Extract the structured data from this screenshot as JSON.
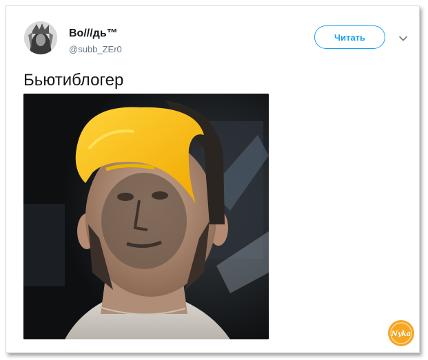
{
  "tweet": {
    "author_name": "Во///дь™",
    "author_handle": "@subb_ZEr0",
    "follow_label": "Читать",
    "text": "Бьютиблогер"
  },
  "icons": {
    "avatar": "avatar-portrait",
    "caret": "chevron-down-icon"
  },
  "watermark": {
    "text": "Nyka"
  },
  "colors": {
    "accent": "#1da1f2",
    "text_primary": "#14171a",
    "text_secondary": "#657786",
    "watermark": "#f5a623"
  }
}
